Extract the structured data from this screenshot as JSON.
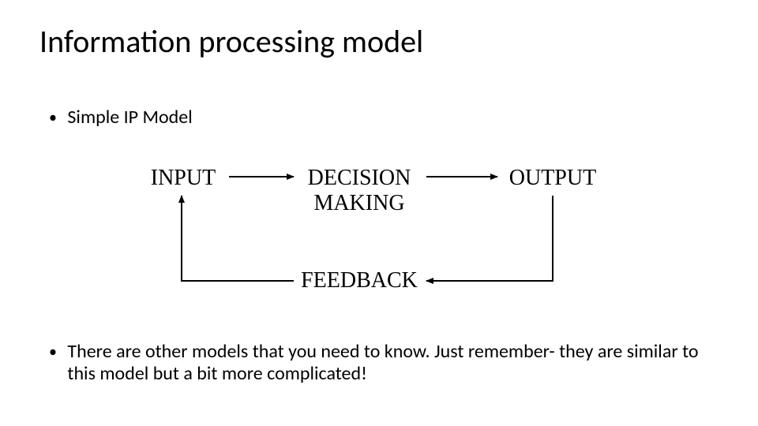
{
  "title": "Information processing model",
  "bullets": {
    "b1": "Simple IP Model",
    "b2": "There are other models that you need to know. Just remember- they are similar to this model but a bit more complicated!"
  },
  "nodes": {
    "input": "INPUT",
    "decision_line1": "DECISION",
    "decision_line2": "MAKING",
    "output": "OUTPUT",
    "feedback": "FEEDBACK"
  }
}
